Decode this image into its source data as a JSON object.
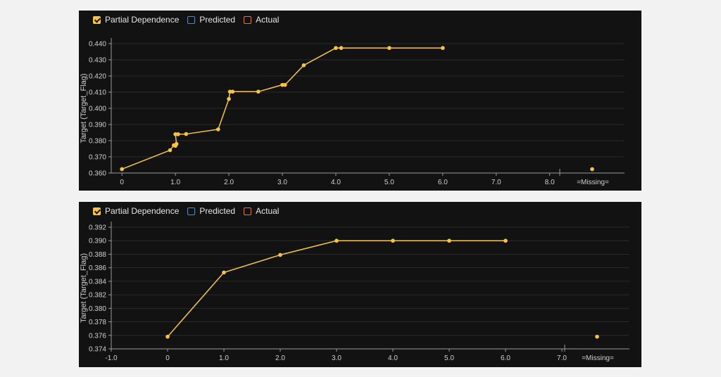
{
  "legend": {
    "items": [
      {
        "label": "Partial Dependence",
        "color": "#f5c542",
        "checked": true
      },
      {
        "label": "Predicted",
        "color": "#3b8fd8",
        "checked": false
      },
      {
        "label": "Actual",
        "color": "#e07a2e",
        "checked": false
      }
    ]
  },
  "colors": {
    "line": "#f5c542",
    "grid": "#2a2a2a",
    "axis": "#9a9a9a"
  },
  "chart_data": [
    {
      "type": "line",
      "title": "",
      "xlabel": "",
      "ylabel": "Target (Target_Flag)",
      "xlim": [
        -0.2,
        9.4
      ],
      "ylim": [
        0.36,
        0.44
      ],
      "x_ticks": [
        0,
        1,
        2,
        3,
        4,
        5,
        6,
        7,
        8
      ],
      "x_tick_labels": [
        "0",
        "1.0",
        "2.0",
        "3.0",
        "4.0",
        "5.0",
        "6.0",
        "7.0",
        "8.0"
      ],
      "y_ticks": [
        0.36,
        0.37,
        0.38,
        0.39,
        0.4,
        0.41,
        0.42,
        0.43,
        0.44
      ],
      "y_tick_labels": [
        "0.360",
        "0.370",
        "0.380",
        "0.390",
        "0.400",
        "0.410",
        "0.420",
        "0.430",
        "0.440"
      ],
      "missing_label": "=Missing=",
      "series": [
        {
          "x": [
            0,
            0.9,
            0.97,
            1.0,
            1.02,
            1.0,
            1.05,
            1.2,
            1.8,
            2.0,
            2.02,
            2.07,
            2.55,
            3.0,
            3.05,
            3.4,
            4.0,
            4.1,
            5.0,
            6.0
          ],
          "y": [
            0.3624,
            0.3741,
            0.3772,
            0.3768,
            0.378,
            0.384,
            0.384,
            0.3841,
            0.387,
            0.4058,
            0.4103,
            0.4103,
            0.4103,
            0.4145,
            0.4145,
            0.4266,
            0.4373,
            0.4373,
            0.4373,
            0.4373
          ]
        }
      ],
      "missing_value": 0.3624
    },
    {
      "type": "line",
      "title": "",
      "xlabel": "",
      "ylabel": "Target (Target_Flag)",
      "xlim": [
        -1.0,
        8.2
      ],
      "ylim": [
        0.374,
        0.392
      ],
      "x_ticks": [
        -1,
        0,
        1,
        2,
        3,
        4,
        5,
        6,
        7
      ],
      "x_tick_labels": [
        "-1.0",
        "0",
        "1.0",
        "2.0",
        "3.0",
        "4.0",
        "5.0",
        "6.0",
        "7.0"
      ],
      "y_ticks": [
        0.374,
        0.376,
        0.378,
        0.38,
        0.382,
        0.384,
        0.386,
        0.388,
        0.39,
        0.392
      ],
      "y_tick_labels": [
        "0.374",
        "0.376",
        "0.378",
        "0.380",
        "0.382",
        "0.384",
        "0.386",
        "0.388",
        "0.390",
        "0.392"
      ],
      "missing_label": "=Missing=",
      "series": [
        {
          "x": [
            0,
            1,
            2,
            3,
            4,
            5,
            6
          ],
          "y": [
            0.3758,
            0.3853,
            0.3879,
            0.39,
            0.39,
            0.39,
            0.39
          ]
        }
      ],
      "missing_value": 0.3758
    }
  ]
}
